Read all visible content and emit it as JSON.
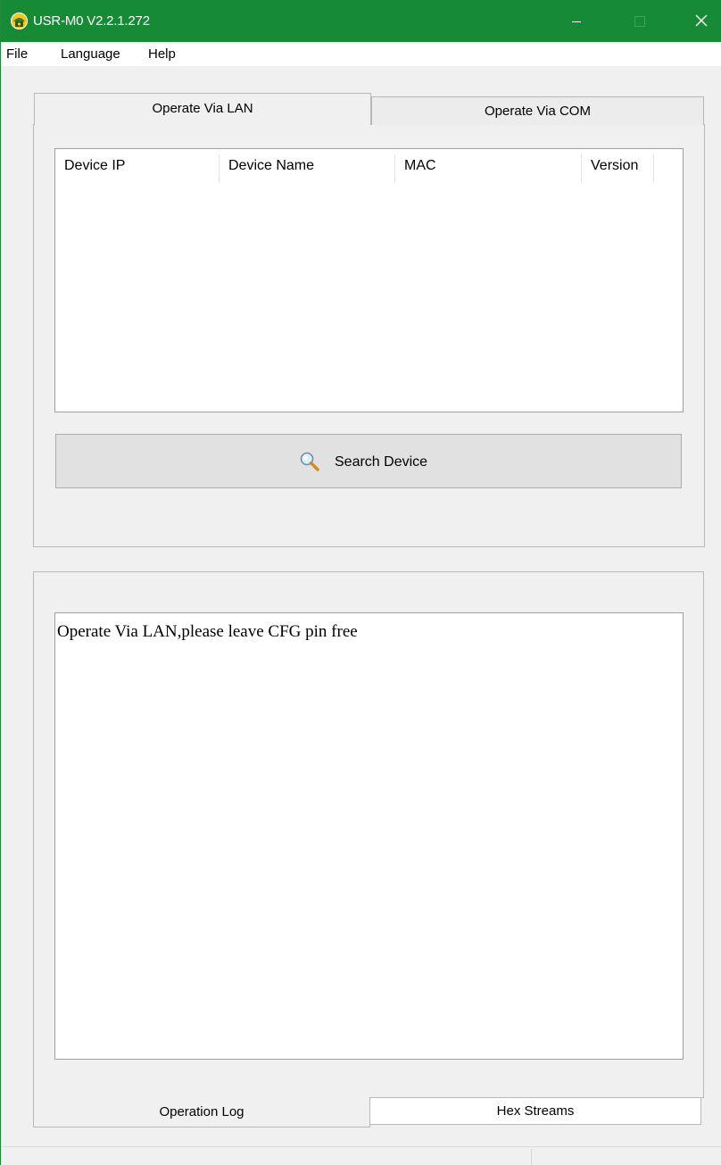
{
  "window": {
    "title": "USR-M0 V2.2.1.272",
    "app_icon": "app-logo-icon",
    "controls": [
      "minimize-icon",
      "maximize-icon",
      "close-icon"
    ],
    "accent_color": "#178a36"
  },
  "menu": {
    "items": [
      {
        "label": "File"
      },
      {
        "label": "Language"
      },
      {
        "label": "Help"
      }
    ]
  },
  "top_tabs": {
    "active": "Operate Via LAN",
    "items": [
      {
        "label": "Operate Via LAN"
      },
      {
        "label": "Operate Via COM"
      }
    ]
  },
  "device_list": {
    "columns": [
      "Device IP",
      "Device Name",
      "MAC",
      "Version"
    ],
    "rows": []
  },
  "search": {
    "label": "Search Device",
    "icon": "magnifier-icon"
  },
  "log": {
    "text": "Operate Via LAN,please leave CFG pin free"
  },
  "bottom_tabs": {
    "active": "Operation Log",
    "items": [
      {
        "label": "Operation Log"
      },
      {
        "label": "Hex Streams"
      }
    ]
  },
  "status": {
    "left": "",
    "right": ""
  }
}
